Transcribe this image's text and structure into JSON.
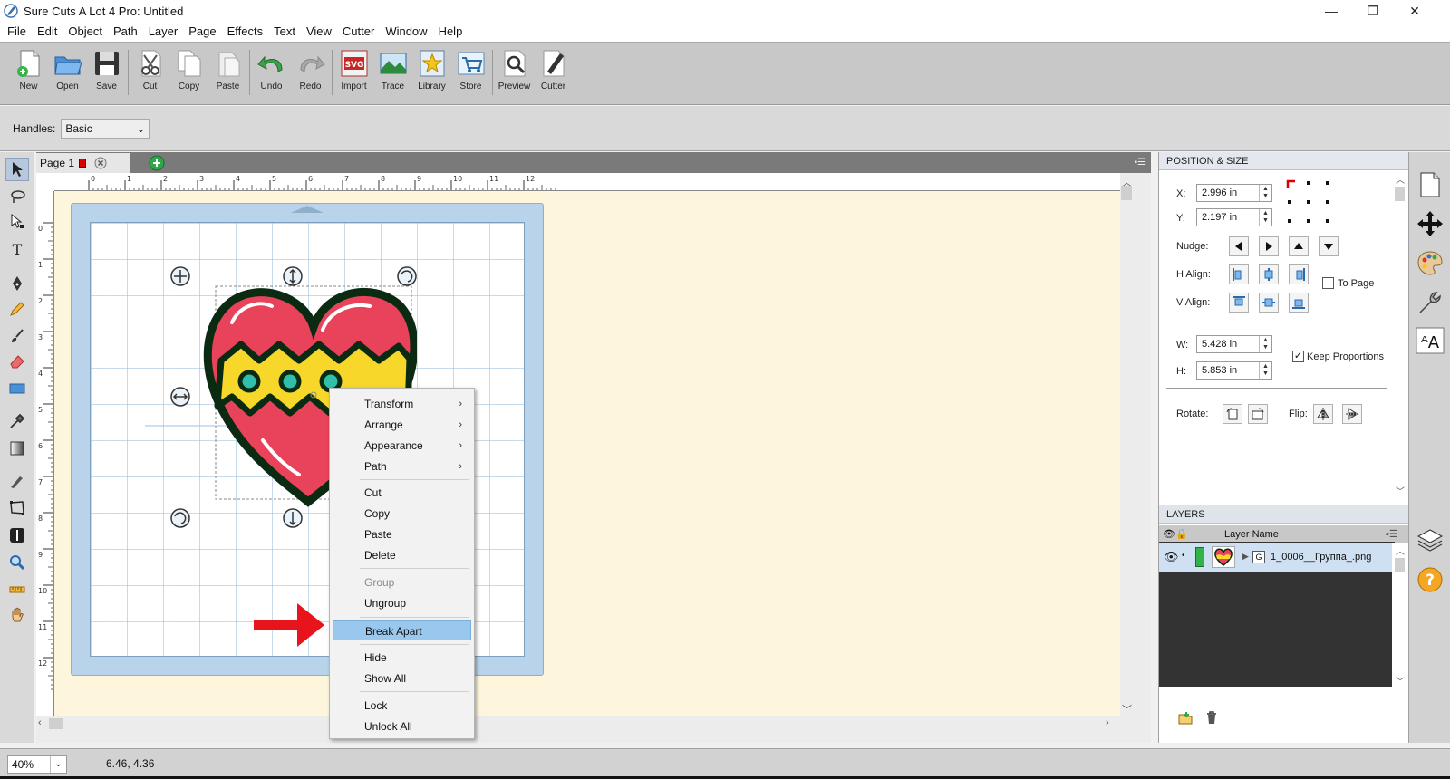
{
  "window": {
    "title": "Sure Cuts A Lot 4 Pro: Untitled",
    "controls": [
      "—",
      "❐",
      "✕"
    ]
  },
  "menubar": [
    "File",
    "Edit",
    "Object",
    "Path",
    "Layer",
    "Page",
    "Effects",
    "Text",
    "View",
    "Cutter",
    "Window",
    "Help"
  ],
  "toolbar": {
    "new": "New",
    "open": "Open",
    "save": "Save",
    "cut": "Cut",
    "copy": "Copy",
    "paste": "Paste",
    "undo": "Undo",
    "redo": "Redo",
    "import": "Import",
    "trace": "Trace",
    "library": "Library",
    "store": "Store",
    "preview": "Preview",
    "cutter": "Cutter"
  },
  "handles": {
    "label": "Handles:",
    "value": "Basic"
  },
  "page_tabs": {
    "page1": "Page 1"
  },
  "ruler": {
    "h_ticks": [
      "0",
      "1",
      "2",
      "3",
      "4",
      "5",
      "6",
      "7",
      "8",
      "9",
      "10",
      "11",
      "12"
    ],
    "v_ticks": [
      "0",
      "1",
      "2",
      "3",
      "4",
      "5",
      "6",
      "7",
      "8",
      "9",
      "10",
      "11",
      "12"
    ]
  },
  "context_menu": {
    "transform": "Transform",
    "arrange": "Arrange",
    "appearance": "Appearance",
    "path": "Path",
    "cut": "Cut",
    "copy": "Copy",
    "paste": "Paste",
    "delete": "Delete",
    "group": "Group",
    "ungroup": "Ungroup",
    "break_apart": "Break Apart",
    "hide": "Hide",
    "show_all": "Show All",
    "lock": "Lock",
    "unlock_all": "Unlock All"
  },
  "position_size": {
    "header": "POSITION & SIZE",
    "x_label": "X:",
    "x_value": "2.996 in",
    "y_label": "Y:",
    "y_value": "2.197 in",
    "nudge_label": "Nudge:",
    "halign_label": "H Align:",
    "valign_label": "V Align:",
    "to_page_label": "To Page",
    "to_page_checked": false,
    "w_label": "W:",
    "w_value": "5.428 in",
    "h_label": "H:",
    "h_value": "5.853 in",
    "keep_proportions_label": "Keep Proportions",
    "keep_proportions_checked": true,
    "rotate_label": "Rotate:",
    "flip_label": "Flip:"
  },
  "layers": {
    "header": "LAYERS",
    "col_name": "Layer Name",
    "items": [
      {
        "name": "1_0006__Группа_.png"
      }
    ]
  },
  "status": {
    "zoom": "40%",
    "coords": "6.46, 4.36"
  },
  "colors": {
    "heart_fill": "#e8435a",
    "heart_stripe": "#f7d82a",
    "heart_outline": "#0b2a12",
    "heart_glow": "#2fd04b",
    "highlight": "#99c7ee",
    "arrow": "#e8141c",
    "mat": "#b8d3ea",
    "workspace": "#fdf6dd"
  }
}
